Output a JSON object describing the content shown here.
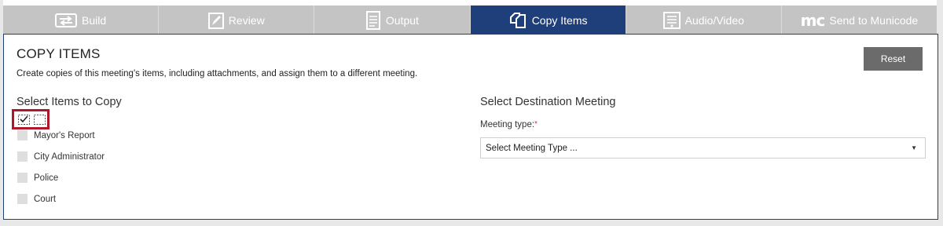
{
  "tabs": [
    {
      "label": "Build",
      "icon": "build-arrows-icon",
      "active": false
    },
    {
      "label": "Review",
      "icon": "pencil-icon",
      "active": false
    },
    {
      "label": "Output",
      "icon": "document-icon",
      "active": false
    },
    {
      "label": "Copy Items",
      "icon": "copy-icon",
      "active": true
    },
    {
      "label": "Audio/Video",
      "icon": "audio-video-icon",
      "active": false
    },
    {
      "label": "Send to Municode",
      "icon": "municode-logo-icon",
      "logo_text": "mc",
      "active": false
    }
  ],
  "page": {
    "title": "COPY ITEMS",
    "description": "Create copies of this meeting's items, including attachments, and assign them to a different meeting.",
    "reset_label": "Reset"
  },
  "items_section": {
    "title": "Select Items to Copy",
    "items": [
      {
        "label": "Mayor's Report",
        "checked": false
      },
      {
        "label": "City Administrator",
        "checked": false
      },
      {
        "label": "Police",
        "checked": false
      },
      {
        "label": "Court",
        "checked": false
      }
    ]
  },
  "destination": {
    "title": "Select Destination Meeting",
    "meeting_type_label": "Meeting type:",
    "required_marker": "*",
    "select_value": "Select Meeting Type ..."
  },
  "colors": {
    "active_tab": "#1f3f7a",
    "inactive_tab": "#c4c4c4",
    "highlight_border": "#b0172b",
    "reset_button": "#6b6b6b"
  }
}
